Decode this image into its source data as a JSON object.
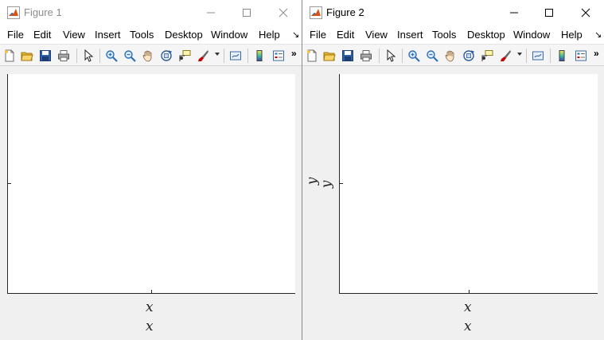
{
  "colors": {
    "matlab_icon": "#d95319",
    "accent_red": "#c00000",
    "axes_edge": "#262626"
  },
  "figure1": {
    "title": "Figure 1",
    "window_controls": [
      "minimize-icon",
      "maximize-icon",
      "close-icon"
    ],
    "menu": [
      "File",
      "Edit",
      "View",
      "Insert",
      "Tools",
      "Desktop",
      "Window",
      "Help"
    ],
    "menu_overflow": "↘",
    "toolbar_icons": [
      "new-figure-icon",
      "open-file-icon",
      "save-icon",
      "print-icon",
      "edit-plot-pointer-icon",
      "zoom-in-icon",
      "zoom-out-icon",
      "pan-hand-icon",
      "rotate-3d-icon",
      "data-cursor-icon",
      "brush-icon",
      "link-plot-icon",
      "colorbar-icon",
      "legend-icon"
    ],
    "toolbar_overflow": "»",
    "xlabel_1": "x",
    "xlabel_2": "x"
  },
  "figure2": {
    "title": "Figure 2",
    "window_controls": [
      "minimize-icon",
      "maximize-icon",
      "close-icon"
    ],
    "menu": [
      "File",
      "Edit",
      "View",
      "Insert",
      "Tools",
      "Desktop",
      "Window",
      "Help"
    ],
    "menu_overflow": "↘",
    "toolbar_icons": [
      "new-figure-icon",
      "open-file-icon",
      "save-icon",
      "print-icon",
      "edit-plot-pointer-icon",
      "zoom-in-icon",
      "zoom-out-icon",
      "pan-hand-icon",
      "rotate-3d-icon",
      "data-cursor-icon",
      "brush-icon",
      "link-plot-icon",
      "colorbar-icon",
      "legend-icon"
    ],
    "toolbar_overflow": "»",
    "ylabel_1": "y",
    "ylabel_2": "y",
    "xlabel_1": "x",
    "xlabel_2": "x"
  }
}
